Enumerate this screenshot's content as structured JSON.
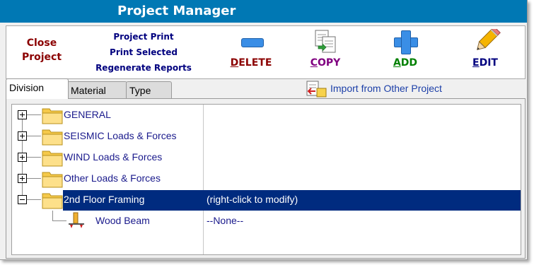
{
  "title": "Project Manager",
  "toolbar": {
    "close_label": "Close Project",
    "print_links": [
      "Project Print",
      "Print Selected",
      "Regenerate Reports"
    ],
    "delete": {
      "underline": "D",
      "rest": "ELETE",
      "color": "#8b0000",
      "icon": "minus-icon"
    },
    "copy": {
      "underline": "C",
      "rest": "OPY",
      "color": "#800080",
      "icon": "copy-documents-icon"
    },
    "add": {
      "underline": "A",
      "rest": "DD",
      "color": "#008000",
      "icon": "plus-icon"
    },
    "edit": {
      "underline": "E",
      "rest": "DIT",
      "color": "#00007f",
      "icon": "pencil-icon"
    }
  },
  "tabs": [
    {
      "label": "Division",
      "active": true
    },
    {
      "label": "Material",
      "active": false
    },
    {
      "label": "Type",
      "active": false
    }
  ],
  "import_link": "Import from Other Project",
  "tree": {
    "items": [
      {
        "label": "GENERAL",
        "expanded": false,
        "selected": false
      },
      {
        "label": "SEISMIC Loads & Forces",
        "expanded": false,
        "selected": false
      },
      {
        "label": "WIND Loads & Forces",
        "expanded": false,
        "selected": false
      },
      {
        "label": "Other Loads & Forces",
        "expanded": false,
        "selected": false
      },
      {
        "label": "2nd Floor Framing",
        "expanded": true,
        "selected": true,
        "note": "(right-click to modify)"
      }
    ],
    "child": {
      "label": "Wood Beam",
      "value": "--None--",
      "icon": "wood-beam-icon"
    }
  },
  "colors": {
    "titlebar": "#0078b4",
    "selection": "#002b7f",
    "tree_text": "#1a1a8c",
    "folder": "#fbd76a"
  }
}
